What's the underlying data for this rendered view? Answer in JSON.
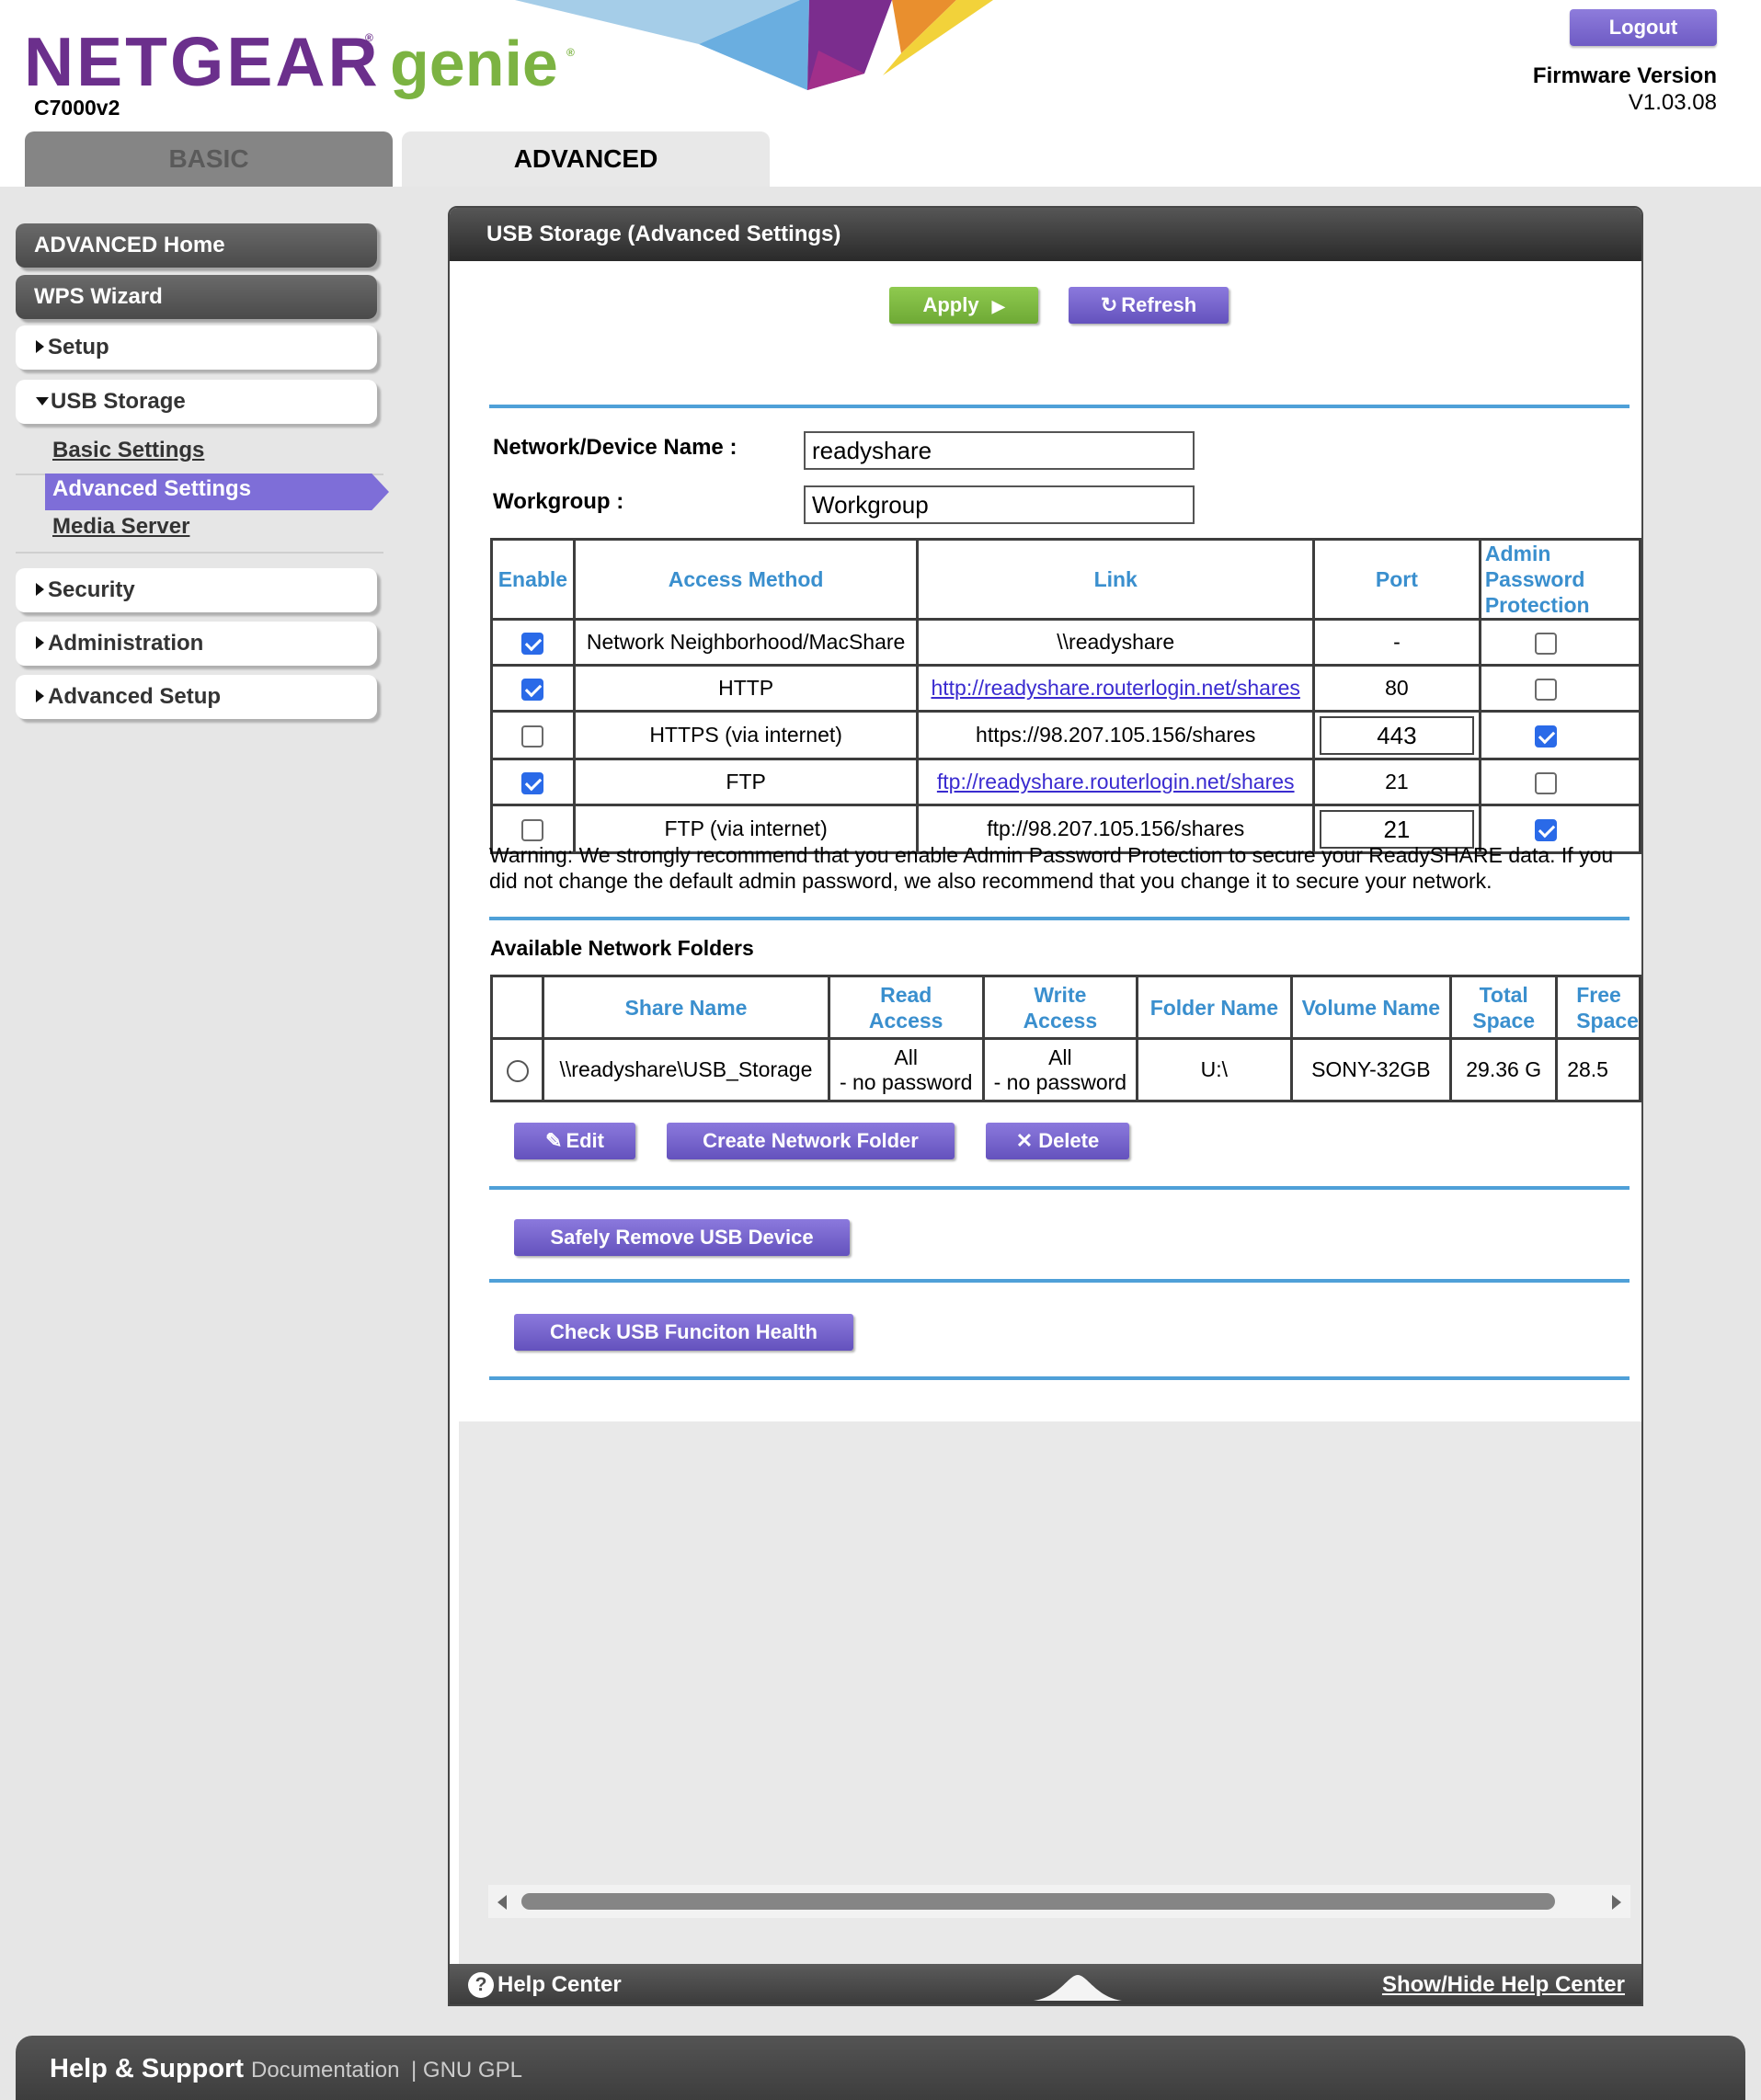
{
  "header": {
    "brand": "NETGEAR",
    "product": "genie",
    "model": "C7000v2",
    "logout_label": "Logout",
    "firmware_label": "Firmware Version",
    "firmware_value": "V1.03.08",
    "tabs": [
      "BASIC",
      "ADVANCED"
    ],
    "active_tab": "ADVANCED"
  },
  "sidebar": {
    "items": [
      {
        "label": "ADVANCED Home"
      },
      {
        "label": "WPS Wizard"
      },
      {
        "label": "Setup"
      },
      {
        "label": "USB Storage",
        "expanded": true,
        "subitems": [
          {
            "label": "Basic Settings"
          },
          {
            "label": "Advanced Settings",
            "active": true
          },
          {
            "label": "Media Server"
          }
        ]
      },
      {
        "label": "Security"
      },
      {
        "label": "Administration"
      },
      {
        "label": "Advanced Setup"
      }
    ]
  },
  "panel": {
    "title": "USB Storage (Advanced Settings)",
    "apply_label": "Apply",
    "refresh_label": "Refresh",
    "device_name_label": "Network/Device Name :",
    "device_name_value": "readyshare",
    "workgroup_label": "Workgroup :",
    "workgroup_value": "Workgroup",
    "access_table": {
      "headers": [
        "Enable",
        "Access Method",
        "Link",
        "Port",
        "Admin Password Protection"
      ],
      "header_port": "Port",
      "rows": [
        {
          "enabled": true,
          "method": "Network Neighborhood/MacShare",
          "link": "\\\\readyshare",
          "link_is_url": false,
          "port": "-",
          "port_editable": false,
          "admin_pw": false
        },
        {
          "enabled": true,
          "method": "HTTP",
          "link": "http://readyshare.routerlogin.net/shares",
          "link_is_url": true,
          "port": "80",
          "port_editable": false,
          "admin_pw": false
        },
        {
          "enabled": false,
          "method": "HTTPS (via internet)",
          "link": "https://98.207.105.156/shares",
          "link_is_url": false,
          "port": "443",
          "port_editable": true,
          "admin_pw": true
        },
        {
          "enabled": true,
          "method": "FTP",
          "link": "ftp://readyshare.routerlogin.net/shares",
          "link_is_url": true,
          "port": "21",
          "port_editable": false,
          "admin_pw": false
        },
        {
          "enabled": false,
          "method": "FTP (via internet)",
          "link": "ftp://98.207.105.156/shares",
          "link_is_url": false,
          "port": "21",
          "port_editable": true,
          "admin_pw": true
        }
      ]
    },
    "warning_line1": "Warning: We strongly recommend that you enable Admin Password Protection to secure your ReadySHARE data. If you",
    "warning_line2": "did not change the default admin password, we also recommend that you change it to secure your network.",
    "folders_title": "Available Network Folders",
    "folders_table": {
      "h_share_name": "Share Name",
      "h_read_1": "Read",
      "h_read_2": "Access",
      "h_write_1": "Write",
      "h_write_2": "Access",
      "h_folder_name": "Folder Name",
      "h_volume_name": "Volume Name",
      "h_total_1": "Total",
      "h_total_2": "Space",
      "h_free_1": "Free",
      "h_free_2": "Space",
      "rows": [
        {
          "selected": false,
          "share_name": "\\\\readyshare\\USB_Storage",
          "read_1": "All",
          "read_2": "- no password",
          "write_1": "All",
          "write_2": "- no password",
          "folder_name": "U:\\",
          "volume_name": "SONY-32GB",
          "total_space": "29.36 G",
          "free_space": "28.5"
        }
      ]
    },
    "edit_label": "Edit",
    "create_folder_label": "Create Network Folder",
    "delete_label": "Delete",
    "safely_remove_label": "Safely Remove USB Device",
    "check_health_label": "Check USB Funciton Health",
    "help_center_label": "Help Center",
    "show_hide_label": "Show/Hide Help Center"
  },
  "footer": {
    "title": "Help & Support",
    "documentation": "Documentation",
    "gpl": "| GNU GPL"
  },
  "colors": {
    "brand_purple": "#6b2f8c",
    "genie_green": "#7cb342",
    "button_purple": "#7462cc",
    "apply_green": "#7fba42",
    "header_blue": "#3a8fce"
  }
}
